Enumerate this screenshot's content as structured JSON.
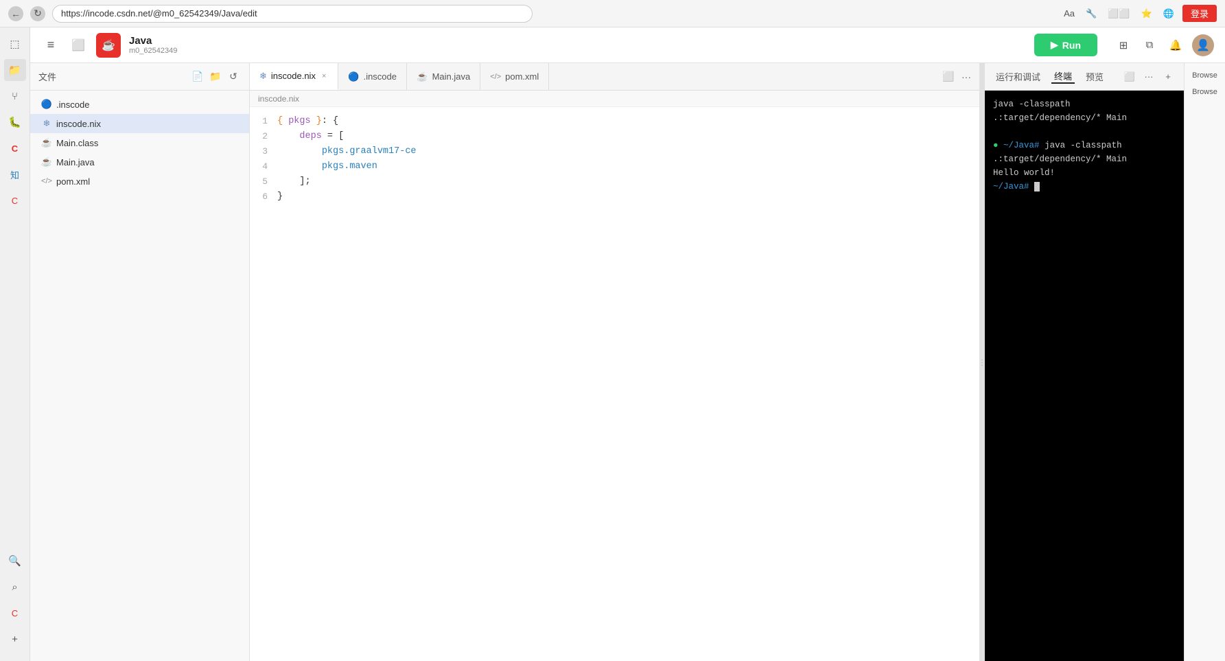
{
  "browser": {
    "url": "https://incode.csdn.net/@m0_62542349/Java/edit",
    "login_label": "登录"
  },
  "topbar": {
    "project_name": "Java",
    "project_user": "m0_62542349",
    "run_label": "▶ Run",
    "hamburger_label": "≡",
    "layout_label": "⬜"
  },
  "file_sidebar": {
    "title": "文件",
    "files": [
      {
        "name": ".inscode",
        "icon": "🔵",
        "type": "inscode"
      },
      {
        "name": "inscode.nix",
        "icon": "❄",
        "type": "nix",
        "active": true
      },
      {
        "name": "Main.class",
        "icon": "☕",
        "type": "class"
      },
      {
        "name": "Main.java",
        "icon": "☕",
        "type": "java"
      },
      {
        "name": "pom.xml",
        "icon": "📄",
        "type": "xml"
      }
    ]
  },
  "tabs": [
    {
      "label": "inscode.nix",
      "icon": "❄",
      "active": true,
      "closable": true
    },
    {
      "label": ".inscode",
      "icon": "🔵",
      "active": false,
      "closable": false
    },
    {
      "label": "Main.java",
      "icon": "☕",
      "active": false,
      "closable": false
    },
    {
      "label": "pom.xml",
      "icon": "📄",
      "active": false,
      "closable": false
    }
  ],
  "code": {
    "filename": "inscode.nix",
    "lines": [
      {
        "num": 1,
        "content": "{ pkgs }: {"
      },
      {
        "num": 2,
        "content": "    deps = ["
      },
      {
        "num": 3,
        "content": "        pkgs.graalvm17-ce"
      },
      {
        "num": 4,
        "content": "        pkgs.maven"
      },
      {
        "num": 5,
        "content": "    ];"
      },
      {
        "num": 6,
        "content": "}"
      }
    ]
  },
  "terminal": {
    "tabs": [
      "运行和调试",
      "终端",
      "预览"
    ],
    "active_tab": "终端",
    "lines": [
      "java -classpath .:target/dependency/* Main",
      "",
      "java -classpath .:target/dependency/* Main",
      "Hello world!",
      "~/Java# "
    ],
    "prompt_prefix": "~/Java#"
  },
  "right_panel": {
    "buttons": [
      "Browse",
      "Browse"
    ]
  },
  "icons": {
    "hamburger": "≡",
    "layout": "⬛",
    "bell": "🔔",
    "grid": "⊞",
    "split": "⧉",
    "plus": "+",
    "search": "🔍",
    "refresh": "↻",
    "back": "←",
    "new_file": "📄",
    "new_folder": "📁",
    "refresh_files": "↺"
  }
}
